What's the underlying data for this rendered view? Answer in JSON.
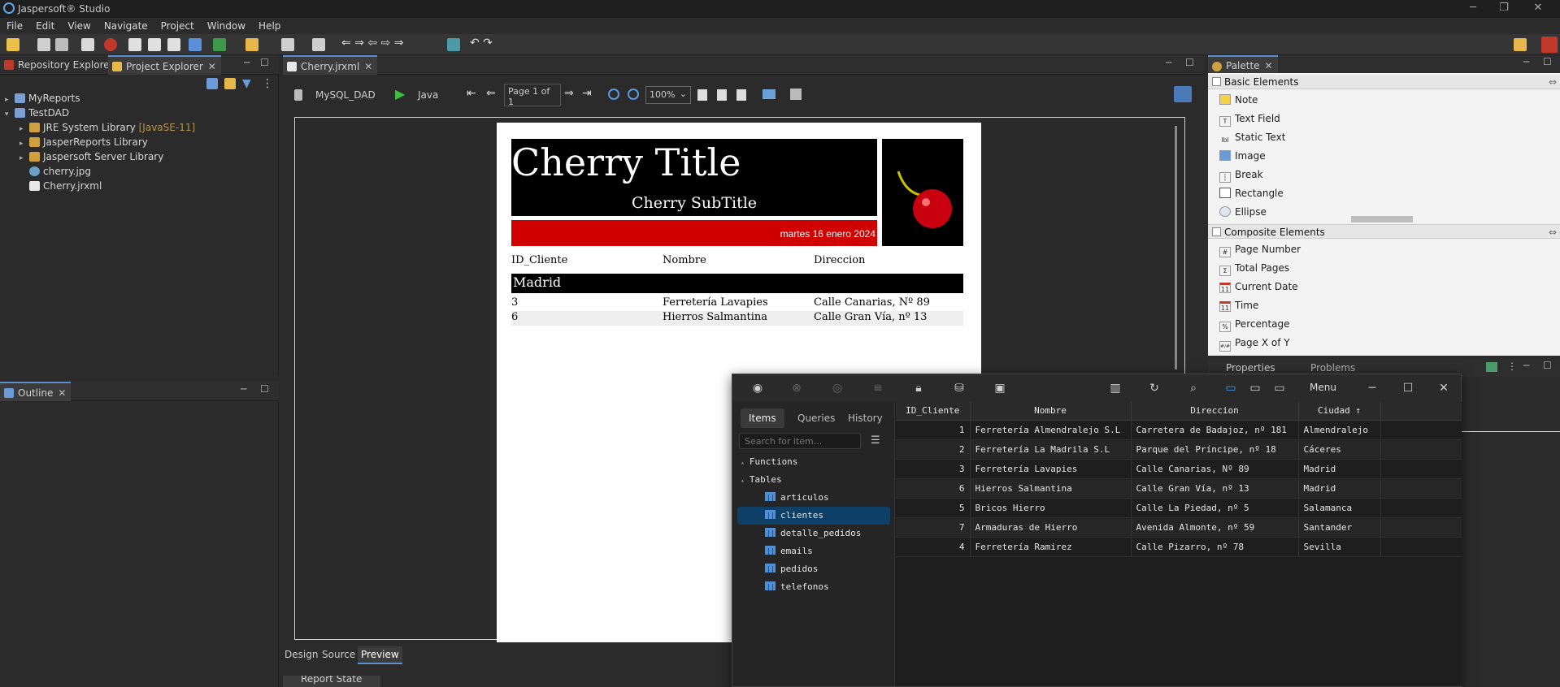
{
  "app": {
    "title": "Jaspersoft® Studio"
  },
  "menu": [
    "File",
    "Edit",
    "View",
    "Navigate",
    "Project",
    "Window",
    "Help"
  ],
  "left_tabs": {
    "repo": "Repository Explorer",
    "project": "Project Explorer"
  },
  "project_tree": [
    {
      "label": "MyReports",
      "indent": 0,
      "arrow": "▸"
    },
    {
      "label": "TestDAD",
      "indent": 0,
      "arrow": "▾"
    },
    {
      "label": "JRE System Library",
      "suffix": "[JavaSE-11]",
      "indent": 1,
      "arrow": "▸"
    },
    {
      "label": "JasperReports Library",
      "indent": 1,
      "arrow": "▸"
    },
    {
      "label": "Jaspersoft Server Library",
      "indent": 1,
      "arrow": "▸"
    },
    {
      "label": "cherry.jpg",
      "indent": 1,
      "arrow": ""
    },
    {
      "label": "Cherry.jrxml",
      "indent": 1,
      "arrow": ""
    }
  ],
  "outline_tab": "Outline",
  "editor": {
    "tab": "Cherry.jrxml",
    "datasource": "MySQL_DAD",
    "lang": "Java",
    "page": "Page 1 of 1",
    "zoom": "100%",
    "bottom_tabs": [
      "Design",
      "Source",
      "Preview"
    ],
    "report_state": "Report State"
  },
  "report": {
    "title": "Cherry Title",
    "subtitle": "Cherry SubTitle",
    "date": "martes 16 enero 2024",
    "columns": [
      "ID_Cliente",
      "Nombre",
      "Direccion"
    ],
    "group": "Madrid",
    "rows": [
      [
        "3",
        "Ferretería Lavapies",
        "Calle Canarias, Nº 89"
      ],
      [
        "6",
        "Hierros Salmantina",
        "Calle Gran Vía, nº 13"
      ]
    ]
  },
  "palette": {
    "tab": "Palette",
    "basic_header": "Basic Elements",
    "basic": [
      {
        "label": "Note",
        "icon": "note-icon"
      },
      {
        "label": "Text Field",
        "icon": "text-field-icon"
      },
      {
        "label": "Static Text",
        "icon": "label-icon"
      },
      {
        "label": "Image",
        "icon": "image-icon"
      },
      {
        "label": "Break",
        "icon": "break-icon"
      },
      {
        "label": "Rectangle",
        "icon": "rectangle-icon"
      },
      {
        "label": "Ellipse",
        "icon": "ellipse-icon"
      }
    ],
    "composite_header": "Composite Elements",
    "composite": [
      {
        "label": "Page Number",
        "icon": "#"
      },
      {
        "label": "Total Pages",
        "icon": "Σ"
      },
      {
        "label": "Current Date",
        "icon": "11"
      },
      {
        "label": "Time",
        "icon": "11"
      },
      {
        "label": "Percentage",
        "icon": "%"
      },
      {
        "label": "Page X of Y",
        "icon": "#/#"
      }
    ]
  },
  "properties_tabs": {
    "properties": "Properties",
    "problems": "Problems"
  },
  "db": {
    "menu": "Menu",
    "tabs": [
      "Items",
      "Queries",
      "History"
    ],
    "search_placeholder": "Search for item...",
    "functions": "Functions",
    "tables_label": "Tables",
    "tables": [
      "articulos",
      "clientes",
      "detalle_pedidos",
      "emails",
      "pedidos",
      "telefonos"
    ],
    "selected_table": "clientes",
    "columns": [
      "ID_Cliente",
      "Nombre",
      "Direccion",
      "Ciudad ↑"
    ],
    "rows": [
      [
        "1",
        "Ferretería Almendralejo S.L",
        "Carretera de Badajoz, nº 181",
        "Almendralejo"
      ],
      [
        "2",
        "Ferretería La Madrila S.L",
        "Parque del Príncipe, nº 18",
        "Cáceres"
      ],
      [
        "3",
        "Ferretería Lavapies",
        "Calle Canarias, Nº 89",
        "Madrid"
      ],
      [
        "6",
        "Hierros Salmantina",
        "Calle Gran Vía, nº 13",
        "Madrid"
      ],
      [
        "5",
        "Bricos Hierro",
        "Calle La Piedad, nº 5",
        "Salamanca"
      ],
      [
        "7",
        "Armaduras de Hierro",
        "Avenida Almonte, nº 59",
        "Santander"
      ],
      [
        "4",
        "Ferretería Ramirez",
        "Calle Pizarro, nº 78",
        "Sevilla"
      ]
    ]
  }
}
